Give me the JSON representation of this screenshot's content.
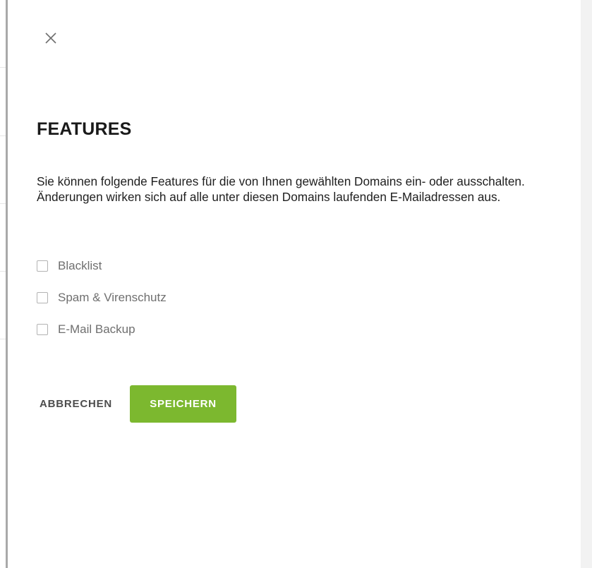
{
  "dialog": {
    "close_icon": "close-icon",
    "title": "FEATURES",
    "description": "Sie können folgende Features für die von Ihnen gewählten Domains ein- oder ausschalten. Änderungen wirken sich auf alle unter diesen Domains laufenden E-Mailadressen aus.",
    "features": [
      {
        "label": "Blacklist",
        "checked": false
      },
      {
        "label": "Spam & Virenschutz",
        "checked": false
      },
      {
        "label": "E-Mail Backup",
        "checked": false
      }
    ],
    "cancel_label": "ABBRECHEN",
    "save_label": "SPEICHERN"
  },
  "colors": {
    "accent": "#7cb82f",
    "title": "#1a1a1a",
    "label": "#6f6f6f",
    "border": "#a9a9a9"
  }
}
